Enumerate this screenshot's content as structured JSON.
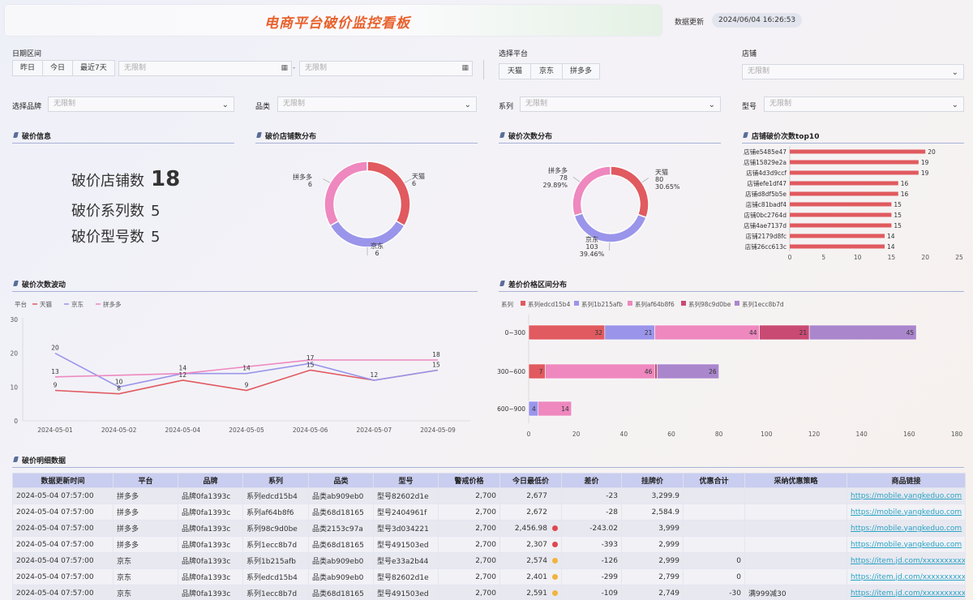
{
  "header": {
    "title": "电商平台破价监控看板",
    "update_label": "数据更新",
    "update_time": "2024/06/04 16:26:53"
  },
  "filters": {
    "date_label": "日期区间",
    "date_buttons": [
      "昨日",
      "今日",
      "最近7天"
    ],
    "date_start": "无限制",
    "date_sep": "-",
    "date_end": "无限制",
    "platform_label": "选择平台",
    "platform_buttons": [
      "天猫",
      "京东",
      "拼多多"
    ],
    "store_label": "店铺",
    "store_value": "无限制",
    "brand_label": "选择品牌",
    "brand_value": "无限制",
    "category_label": "品类",
    "category_value": "无限制",
    "series_label": "系列",
    "series_value": "无限制",
    "model_label": "型号",
    "model_value": "无限制"
  },
  "sections": {
    "info": "破价信息",
    "store_dist": "破价店铺数分布",
    "count_dist": "破价次数分布",
    "top10": "店铺破价次数top10",
    "trend": "破价次数波动",
    "range": "差价价格区间分布",
    "detail": "破价明细数据"
  },
  "kpis": [
    {
      "label": "破价店铺数",
      "value": "18"
    },
    {
      "label": "破价系列数",
      "value": "5"
    },
    {
      "label": "破价型号数",
      "value": "5"
    }
  ],
  "colors": {
    "tmall": "#e05a5f",
    "jd": "#9a95ea",
    "pdd": "#ee88bf",
    "s4": "#c94a72",
    "s5": "#aa86cc"
  },
  "chart_data": [
    {
      "type": "pie",
      "title": "破价店铺数分布",
      "labels": [
        "天猫",
        "京东",
        "拼多多"
      ],
      "values": [
        6,
        6,
        6
      ]
    },
    {
      "type": "pie",
      "title": "破价次数分布",
      "labels": [
        "天猫",
        "京东",
        "拼多多"
      ],
      "values": [
        80,
        103,
        78
      ],
      "percents": [
        "30.65%",
        "39.46%",
        "29.89%"
      ]
    },
    {
      "type": "bar",
      "title": "店铺破价次数top10",
      "categories": [
        "店铺e5485e47",
        "店铺15829e2a",
        "店铺4d3d9ccf",
        "店铺efe1df47",
        "店铺d8df5b5e",
        "店铺c81badf4",
        "店铺0bc2764d",
        "店铺4ae7137d",
        "店铺2179d8fc",
        "店铺26cc613c"
      ],
      "values": [
        20,
        19,
        19,
        16,
        16,
        15,
        15,
        15,
        14,
        14
      ],
      "xlim": [
        0,
        25
      ],
      "xticks": [
        0,
        5,
        10,
        15,
        20,
        25
      ]
    },
    {
      "type": "line",
      "title": "破价次数波动",
      "legend_title": "平台",
      "x": [
        "2024-05-01",
        "2024-05-02",
        "2024-05-04",
        "2024-05-05",
        "2024-05-06",
        "2024-05-07",
        "2024-05-09"
      ],
      "ylim": [
        0,
        30
      ],
      "yticks": [
        0,
        10,
        20,
        30
      ],
      "series": [
        {
          "name": "天猫",
          "values": [
            9,
            8,
            12,
            9,
            15,
            12,
            15
          ]
        },
        {
          "name": "京东",
          "values": [
            20,
            10,
            14,
            14,
            17,
            12,
            15
          ]
        },
        {
          "name": "拼多多",
          "values": [
            13,
            null,
            14,
            null,
            18,
            null,
            18
          ]
        }
      ],
      "labels": [
        {
          "x": 0,
          "y": 20,
          "t": "20"
        },
        {
          "x": 0,
          "y": 13,
          "t": "13"
        },
        {
          "x": 0,
          "y": 9,
          "t": "9"
        },
        {
          "x": 1,
          "y": 10,
          "t": "10"
        },
        {
          "x": 1,
          "y": 8,
          "t": "8"
        },
        {
          "x": 2,
          "y": 14,
          "t": "14"
        },
        {
          "x": 2,
          "y": 12,
          "t": "12"
        },
        {
          "x": 3,
          "y": 14,
          "t": "14"
        },
        {
          "x": 3,
          "y": 9,
          "t": "9"
        },
        {
          "x": 4,
          "y": 17,
          "t": "17"
        },
        {
          "x": 4,
          "y": 15,
          "t": "15"
        },
        {
          "x": 5,
          "y": 12,
          "t": "12"
        },
        {
          "x": 6,
          "y": 18,
          "t": "18"
        },
        {
          "x": 6,
          "y": 15,
          "t": "15"
        }
      ]
    },
    {
      "type": "bar",
      "title": "差价价格区间分布",
      "legend_title": "系列",
      "orientation": "horizontal-stacked",
      "categories": [
        "0~300",
        "300~600",
        "600~900"
      ],
      "series": [
        {
          "name": "系列edcd15b4",
          "values": [
            32,
            7,
            0
          ]
        },
        {
          "name": "系列1b215afb",
          "values": [
            21,
            0,
            4
          ]
        },
        {
          "name": "系列af64b8f6",
          "values": [
            44,
            46,
            14
          ]
        },
        {
          "name": "系列98c9d0be",
          "values": [
            21,
            1,
            0
          ]
        },
        {
          "name": "系列1ecc8b7d",
          "values": [
            45,
            26,
            0
          ]
        }
      ],
      "segment_labels": [
        [
          "32",
          "21",
          "44",
          "21",
          "45"
        ],
        [
          "7",
          "",
          "46",
          "",
          "26"
        ],
        [
          "",
          "4",
          "14",
          "",
          ""
        ]
      ],
      "xlim": [
        0,
        180
      ],
      "xticks": [
        0,
        20,
        40,
        60,
        80,
        100,
        120,
        140,
        160,
        180
      ]
    }
  ],
  "table": {
    "headers": [
      "数据更新时间",
      "平台",
      "品牌",
      "系列",
      "品类",
      "型号",
      "警戒价格",
      "今日最低价",
      "差价",
      "挂牌价",
      "优惠合计",
      "采纳优惠策略",
      "商品链接"
    ],
    "rows": [
      [
        "2024-05-04 07:57:00",
        "拼多多",
        "品牌0fa1393c",
        "系列edcd15b4",
        "品类ab909eb0",
        "型号82602d1e",
        "2,700",
        "2,677",
        "",
        "-23",
        "3,299.9",
        "",
        "",
        "https://mobile.yangkeduo.com"
      ],
      [
        "2024-05-04 07:57:00",
        "拼多多",
        "品牌0fa1393c",
        "系列af64b8f6",
        "品类68d18165",
        "型号2404961f",
        "2,700",
        "2,672",
        "",
        "-28",
        "2,584.9",
        "",
        "",
        "https://mobile.yangkeduo.com"
      ],
      [
        "2024-05-04 07:57:00",
        "拼多多",
        "品牌0fa1393c",
        "系列98c9d0be",
        "品类2153c97a",
        "型号3d034221",
        "2,700",
        "2,456.98",
        "red",
        "-243.02",
        "3,999",
        "",
        "",
        "https://mobile.yangkeduo.com"
      ],
      [
        "2024-05-04 07:57:00",
        "拼多多",
        "品牌0fa1393c",
        "系列1ecc8b7d",
        "品类68d18165",
        "型号491503ed",
        "2,700",
        "2,307",
        "red",
        "-393",
        "2,999",
        "",
        "",
        "https://mobile.yangkeduo.com"
      ],
      [
        "2024-05-04 07:57:00",
        "京东",
        "品牌0fa1393c",
        "系列1b215afb",
        "品类ab909eb0",
        "型号e33a2b44",
        "2,700",
        "2,574",
        "orange",
        "-126",
        "2,999",
        "0",
        "",
        "https://item.jd.com/xxxxxxxxxxxxxx"
      ],
      [
        "2024-05-04 07:57:00",
        "京东",
        "品牌0fa1393c",
        "系列edcd15b4",
        "品类ab909eb0",
        "型号82602d1e",
        "2,700",
        "2,401",
        "orange",
        "-299",
        "2,799",
        "0",
        "",
        "https://item.jd.com/xxxxxxxxxxxxxx"
      ],
      [
        "2024-05-04 07:57:00",
        "京东",
        "品牌0fa1393c",
        "系列1ecc8b7d",
        "品类68d18165",
        "型号491503ed",
        "2,700",
        "2,591",
        "orange",
        "-109",
        "2,749",
        "-30",
        "满999减30",
        "https://item.jd.com/xxxxxxxxxxxxxx"
      ]
    ]
  }
}
